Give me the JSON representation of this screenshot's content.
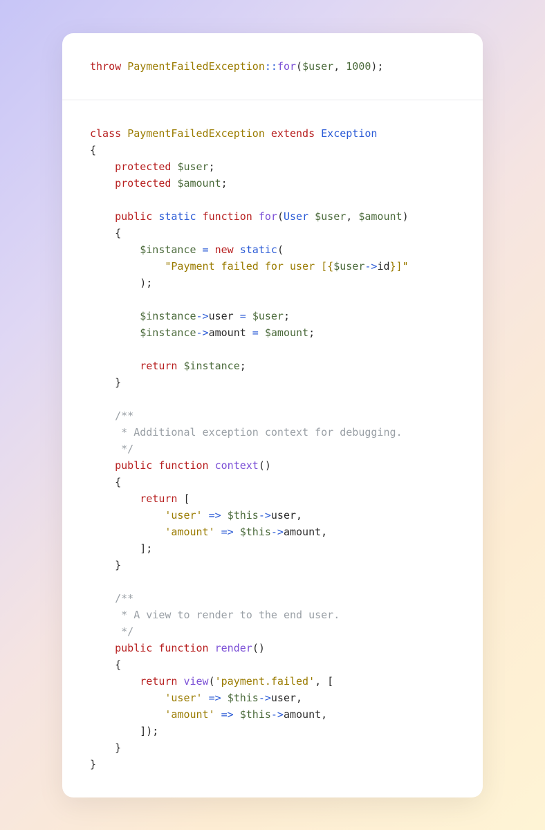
{
  "block1": {
    "t": [
      {
        "t": "throw ",
        "c": "kw-throw"
      },
      {
        "t": "PaymentFailedException",
        "c": "classname"
      },
      {
        "t": "::",
        "c": "op"
      },
      {
        "t": "for",
        "c": "funcname"
      },
      {
        "t": "(",
        "c": "punct"
      },
      {
        "t": "$user",
        "c": "var"
      },
      {
        "t": ", ",
        "c": "punct"
      },
      {
        "t": "1000",
        "c": "num"
      },
      {
        "t": ");",
        "c": "punct"
      }
    ]
  },
  "block2": {
    "lines": [
      [
        {
          "t": "class ",
          "c": "kw-class"
        },
        {
          "t": "PaymentFailedException",
          "c": "classname"
        },
        {
          "t": " extends ",
          "c": "kw-extends"
        },
        {
          "t": "Exception",
          "c": "type"
        }
      ],
      [
        {
          "t": "{",
          "c": "punct"
        }
      ],
      [
        {
          "t": "    ",
          "c": ""
        },
        {
          "t": "protected ",
          "c": "kw-mod"
        },
        {
          "t": "$user",
          "c": "var"
        },
        {
          "t": ";",
          "c": "punct"
        }
      ],
      [
        {
          "t": "    ",
          "c": ""
        },
        {
          "t": "protected ",
          "c": "kw-mod"
        },
        {
          "t": "$amount",
          "c": "var"
        },
        {
          "t": ";",
          "c": "punct"
        }
      ],
      [
        {
          "t": "",
          "c": ""
        }
      ],
      [
        {
          "t": "    ",
          "c": ""
        },
        {
          "t": "public ",
          "c": "kw-mod"
        },
        {
          "t": "static ",
          "c": "kw-static"
        },
        {
          "t": "function ",
          "c": "kw-func"
        },
        {
          "t": "for",
          "c": "funcname"
        },
        {
          "t": "(",
          "c": "punct"
        },
        {
          "t": "User ",
          "c": "type"
        },
        {
          "t": "$user",
          "c": "var"
        },
        {
          "t": ", ",
          "c": "punct"
        },
        {
          "t": "$amount",
          "c": "var"
        },
        {
          "t": ")",
          "c": "punct"
        }
      ],
      [
        {
          "t": "    {",
          "c": "punct"
        }
      ],
      [
        {
          "t": "        ",
          "c": ""
        },
        {
          "t": "$instance",
          "c": "var"
        },
        {
          "t": " = ",
          "c": "op"
        },
        {
          "t": "new ",
          "c": "kw-new"
        },
        {
          "t": "static",
          "c": "kw-static"
        },
        {
          "t": "(",
          "c": "punct"
        }
      ],
      [
        {
          "t": "            ",
          "c": ""
        },
        {
          "t": "\"Payment failed for user [{",
          "c": "str"
        },
        {
          "t": "$user",
          "c": "var"
        },
        {
          "t": "->",
          "c": "op"
        },
        {
          "t": "id",
          "c": "prop"
        },
        {
          "t": "}]\"",
          "c": "str"
        }
      ],
      [
        {
          "t": "        );",
          "c": "punct"
        }
      ],
      [
        {
          "t": "",
          "c": ""
        }
      ],
      [
        {
          "t": "        ",
          "c": ""
        },
        {
          "t": "$instance",
          "c": "var"
        },
        {
          "t": "->",
          "c": "op"
        },
        {
          "t": "user",
          "c": "prop"
        },
        {
          "t": " = ",
          "c": "op"
        },
        {
          "t": "$user",
          "c": "var"
        },
        {
          "t": ";",
          "c": "punct"
        }
      ],
      [
        {
          "t": "        ",
          "c": ""
        },
        {
          "t": "$instance",
          "c": "var"
        },
        {
          "t": "->",
          "c": "op"
        },
        {
          "t": "amount",
          "c": "prop"
        },
        {
          "t": " = ",
          "c": "op"
        },
        {
          "t": "$amount",
          "c": "var"
        },
        {
          "t": ";",
          "c": "punct"
        }
      ],
      [
        {
          "t": "",
          "c": ""
        }
      ],
      [
        {
          "t": "        ",
          "c": ""
        },
        {
          "t": "return ",
          "c": "kw-return"
        },
        {
          "t": "$instance",
          "c": "var"
        },
        {
          "t": ";",
          "c": "punct"
        }
      ],
      [
        {
          "t": "    }",
          "c": "punct"
        }
      ],
      [
        {
          "t": "",
          "c": ""
        }
      ],
      [
        {
          "t": "    ",
          "c": ""
        },
        {
          "t": "/**",
          "c": "comment"
        }
      ],
      [
        {
          "t": "     * Additional exception context for debugging.",
          "c": "comment"
        }
      ],
      [
        {
          "t": "     */",
          "c": "comment"
        }
      ],
      [
        {
          "t": "    ",
          "c": ""
        },
        {
          "t": "public ",
          "c": "kw-mod"
        },
        {
          "t": "function ",
          "c": "kw-func"
        },
        {
          "t": "context",
          "c": "funcname"
        },
        {
          "t": "()",
          "c": "punct"
        }
      ],
      [
        {
          "t": "    {",
          "c": "punct"
        }
      ],
      [
        {
          "t": "        ",
          "c": ""
        },
        {
          "t": "return ",
          "c": "kw-return"
        },
        {
          "t": "[",
          "c": "punct"
        }
      ],
      [
        {
          "t": "            ",
          "c": ""
        },
        {
          "t": "'user'",
          "c": "str"
        },
        {
          "t": " => ",
          "c": "op"
        },
        {
          "t": "$this",
          "c": "var"
        },
        {
          "t": "->",
          "c": "op"
        },
        {
          "t": "user",
          "c": "prop"
        },
        {
          "t": ",",
          "c": "punct"
        }
      ],
      [
        {
          "t": "            ",
          "c": ""
        },
        {
          "t": "'amount'",
          "c": "str"
        },
        {
          "t": " => ",
          "c": "op"
        },
        {
          "t": "$this",
          "c": "var"
        },
        {
          "t": "->",
          "c": "op"
        },
        {
          "t": "amount",
          "c": "prop"
        },
        {
          "t": ",",
          "c": "punct"
        }
      ],
      [
        {
          "t": "        ];",
          "c": "punct"
        }
      ],
      [
        {
          "t": "    }",
          "c": "punct"
        }
      ],
      [
        {
          "t": "",
          "c": ""
        }
      ],
      [
        {
          "t": "    ",
          "c": ""
        },
        {
          "t": "/**",
          "c": "comment"
        }
      ],
      [
        {
          "t": "     * A view to render to the end user.",
          "c": "comment"
        }
      ],
      [
        {
          "t": "     */",
          "c": "comment"
        }
      ],
      [
        {
          "t": "    ",
          "c": ""
        },
        {
          "t": "public ",
          "c": "kw-mod"
        },
        {
          "t": "function ",
          "c": "kw-func"
        },
        {
          "t": "render",
          "c": "funcname"
        },
        {
          "t": "()",
          "c": "punct"
        }
      ],
      [
        {
          "t": "    {",
          "c": "punct"
        }
      ],
      [
        {
          "t": "        ",
          "c": ""
        },
        {
          "t": "return ",
          "c": "kw-return"
        },
        {
          "t": "view",
          "c": "funcname"
        },
        {
          "t": "(",
          "c": "punct"
        },
        {
          "t": "'payment.failed'",
          "c": "str"
        },
        {
          "t": ", [",
          "c": "punct"
        }
      ],
      [
        {
          "t": "            ",
          "c": ""
        },
        {
          "t": "'user'",
          "c": "str"
        },
        {
          "t": " => ",
          "c": "op"
        },
        {
          "t": "$this",
          "c": "var"
        },
        {
          "t": "->",
          "c": "op"
        },
        {
          "t": "user",
          "c": "prop"
        },
        {
          "t": ",",
          "c": "punct"
        }
      ],
      [
        {
          "t": "            ",
          "c": ""
        },
        {
          "t": "'amount'",
          "c": "str"
        },
        {
          "t": " => ",
          "c": "op"
        },
        {
          "t": "$this",
          "c": "var"
        },
        {
          "t": "->",
          "c": "op"
        },
        {
          "t": "amount",
          "c": "prop"
        },
        {
          "t": ",",
          "c": "punct"
        }
      ],
      [
        {
          "t": "        ]);",
          "c": "punct"
        }
      ],
      [
        {
          "t": "    }",
          "c": "punct"
        }
      ],
      [
        {
          "t": "}",
          "c": "punct"
        }
      ]
    ]
  }
}
